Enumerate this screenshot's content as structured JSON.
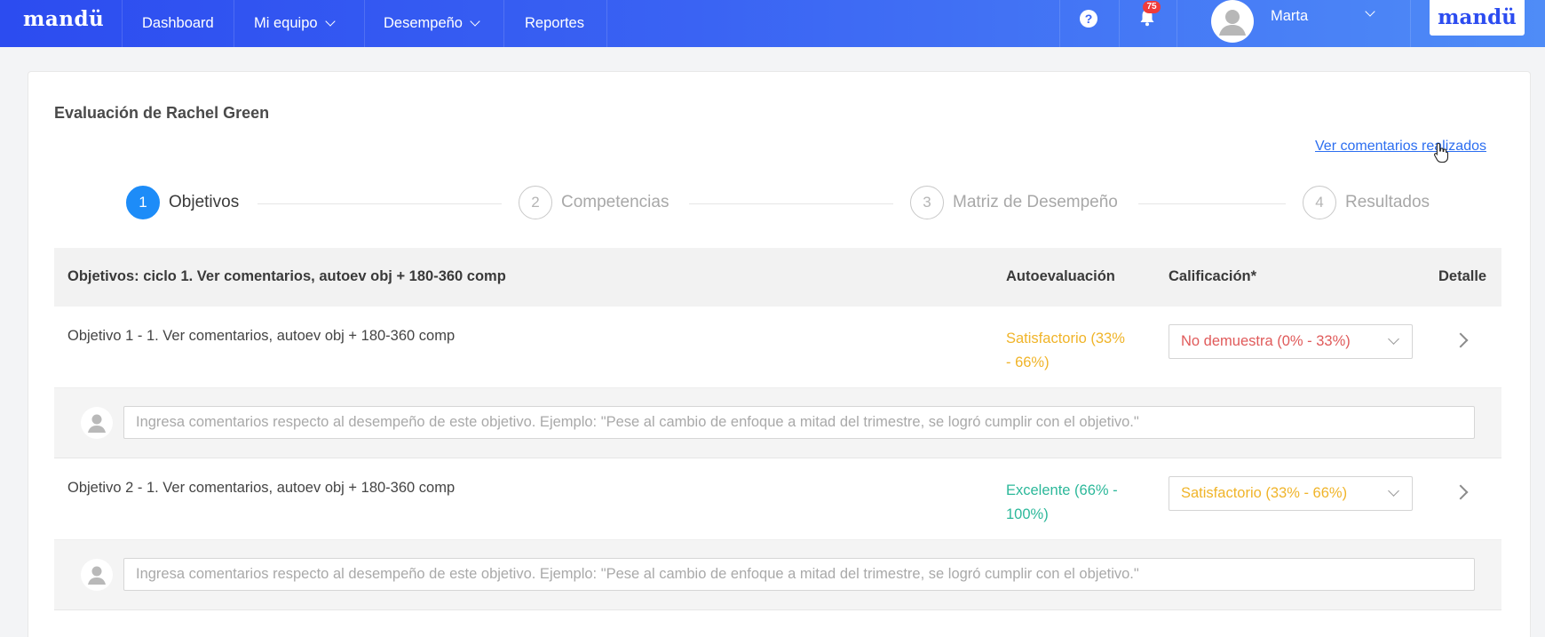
{
  "nav": {
    "brand": "mandü",
    "items": [
      {
        "label": "Dashboard"
      },
      {
        "label": "Mi equipo"
      },
      {
        "label": "Desempeño"
      },
      {
        "label": "Reportes"
      }
    ],
    "help_glyph": "?",
    "notifications_count": "75",
    "user_name": "Marta",
    "logo": "mandü"
  },
  "page": {
    "title": "Evaluación de Rachel Green",
    "comments_link": "Ver comentarios realizados"
  },
  "stepper": {
    "steps": [
      {
        "number": "1",
        "label": "Objetivos",
        "active": true
      },
      {
        "number": "2",
        "label": "Competencias",
        "active": false
      },
      {
        "number": "3",
        "label": "Matriz de Desempeño",
        "active": false
      },
      {
        "number": "4",
        "label": "Resultados",
        "active": false
      }
    ]
  },
  "table": {
    "headers": {
      "objective": "Objetivos: ciclo 1. Ver comentarios, autoev obj + 180-360 comp",
      "self_evaluation": "Autoevaluación",
      "rating": "Calificación*",
      "detail": "Detalle"
    },
    "rows": [
      {
        "title": "Objetivo 1 - 1. Ver comentarios, autoev obj + 180-360 comp",
        "self_evaluation": "Satisfactorio (33% - 66%)",
        "self_evaluation_color": "#f0b429",
        "rating": "No demuestra (0% - 33%)",
        "rating_color": "#e05a5a",
        "comment_placeholder": "Ingresa comentarios respecto al desempeño de este objetivo. Ejemplo: \"Pese al cambio de enfoque a mitad del trimestre, se logró cumplir con el objetivo.\""
      },
      {
        "title": "Objetivo 2 - 1. Ver comentarios, autoev obj + 180-360 comp",
        "self_evaluation": "Excelente (66% - 100%)",
        "self_evaluation_color": "#2cb89a",
        "rating": "Satisfactorio (33% - 66%)",
        "rating_color": "#f0b429",
        "comment_placeholder": "Ingresa comentarios respecto al desempeño de este objetivo. Ejemplo: \"Pese al cambio de enfoque a mitad del trimestre, se logró cumplir con el objetivo.\""
      }
    ]
  },
  "colors": {
    "primary": "#1d8cf8",
    "nav_gradient_start": "#2c4cf0",
    "nav_gradient_end": "#4f8cf7",
    "link": "#2c6ef0"
  }
}
